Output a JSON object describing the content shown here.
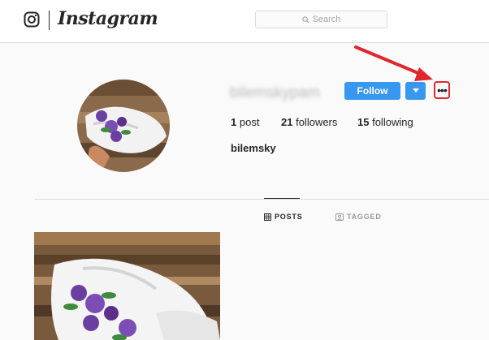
{
  "header": {
    "logo_text": "Instagram",
    "search_placeholder": "Search"
  },
  "profile": {
    "username": "bilemskypam",
    "display_name": "bilemsky",
    "follow_label": "Follow",
    "stats": {
      "posts_count": "1",
      "posts_label": "post",
      "followers_count": "21",
      "followers_label": "followers",
      "following_count": "15",
      "following_label": "following"
    }
  },
  "tabs": [
    {
      "label": "POSTS",
      "icon": "grid-icon",
      "active": true
    },
    {
      "label": "TAGGED",
      "icon": "tag-icon",
      "active": false
    }
  ],
  "colors": {
    "accent": "#3897f0",
    "annotation": "#e0272c"
  }
}
